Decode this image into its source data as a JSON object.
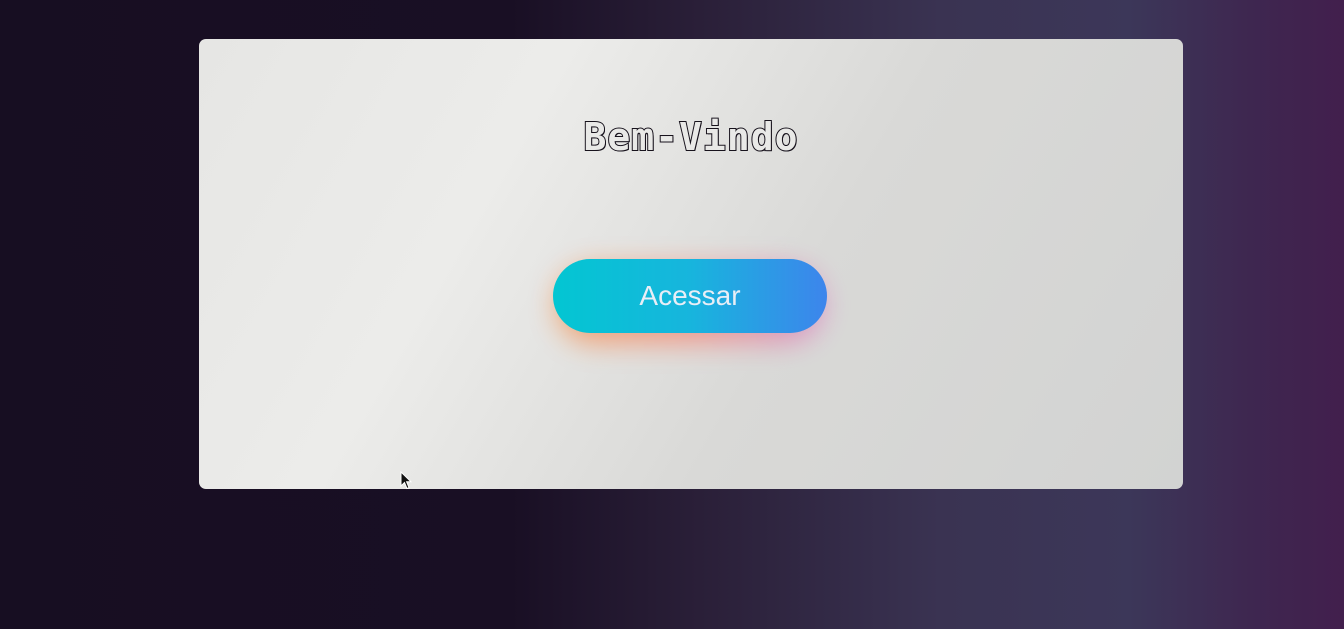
{
  "card": {
    "title": "Bem-Vindo",
    "button_label": "Acessar"
  },
  "colors": {
    "background_left": "#170e22",
    "background_right": "#421f4d",
    "card": "#e6e6e4",
    "button_gradient_start": "#03c6d2",
    "button_gradient_end": "#3d85ec",
    "button_glow": "#f29a5a",
    "title_outline": "#17121c"
  },
  "icons": {
    "cursor": "mouse-pointer-icon"
  }
}
